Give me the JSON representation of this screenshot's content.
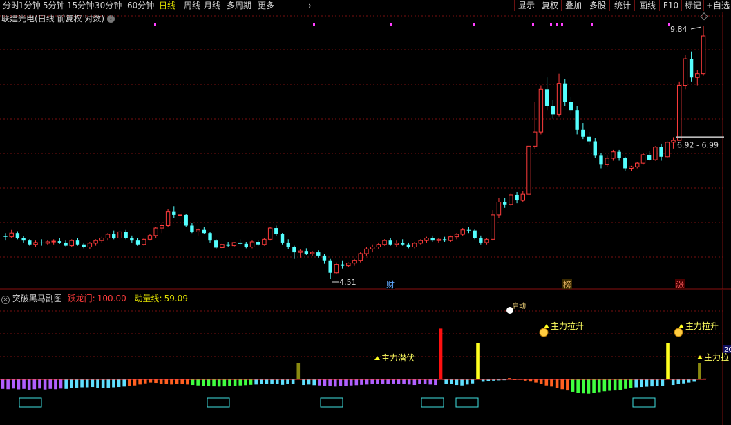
{
  "toolbar": {
    "periods": [
      "分时",
      "1分钟",
      "5分钟",
      "15分钟",
      "30分钟",
      "60分钟",
      "日线",
      "周线",
      "月线",
      "多周期",
      "更多"
    ],
    "active_period": "日线",
    "right_buttons": [
      "显示",
      "复权",
      "叠加",
      "多股",
      "统计",
      "画线",
      "F10",
      "标记",
      "+自选"
    ]
  },
  "stock": {
    "name": "联建光电",
    "mode": "(日线 前复权 对数)"
  },
  "indicator": {
    "name": "突破黑马副图",
    "yl_label": "跃龙门:",
    "yl_value": "100.00",
    "dl_label": "动量线:",
    "dl_value": "59.09",
    "side_value": "20"
  },
  "annotations": {
    "high_label": "9.84",
    "low_label": "4.51",
    "range_label": "6.92 - 6.99",
    "markers": [
      "财",
      "榜",
      "涨"
    ],
    "signals": [
      "启动",
      "主力潜伏",
      "主力拉升",
      "主力拉升",
      "主力拉"
    ]
  },
  "colors": {
    "up": "#ff3c3c",
    "down": "#54ffff",
    "grid": "#7a1010",
    "label": "#dcdc00"
  },
  "chart_data": {
    "type": "candlestick",
    "candles": [
      [
        5.15,
        5.2,
        5.08,
        5.14
      ],
      [
        5.14,
        5.25,
        5.12,
        5.2
      ],
      [
        5.2,
        5.23,
        5.1,
        5.12
      ],
      [
        5.12,
        5.15,
        5.05,
        5.08
      ],
      [
        5.08,
        5.1,
        5.0,
        5.02
      ],
      [
        5.02,
        5.08,
        4.98,
        5.05
      ],
      [
        5.05,
        5.1,
        5.0,
        5.04
      ],
      [
        5.04,
        5.09,
        5.01,
        5.06
      ],
      [
        5.06,
        5.1,
        5.02,
        5.07
      ],
      [
        5.07,
        5.12,
        5.03,
        5.05
      ],
      [
        5.05,
        5.08,
        4.99,
        5.0
      ],
      [
        5.0,
        5.1,
        4.98,
        5.08
      ],
      [
        5.08,
        5.12,
        5.0,
        5.02
      ],
      [
        5.02,
        5.05,
        4.96,
        4.98
      ],
      [
        4.98,
        5.06,
        4.95,
        5.04
      ],
      [
        5.04,
        5.1,
        5.0,
        5.08
      ],
      [
        5.08,
        5.14,
        5.05,
        5.12
      ],
      [
        5.12,
        5.2,
        5.08,
        5.18
      ],
      [
        5.18,
        5.24,
        5.1,
        5.12
      ],
      [
        5.12,
        5.24,
        5.1,
        5.22
      ],
      [
        5.22,
        5.25,
        5.1,
        5.12
      ],
      [
        5.12,
        5.16,
        5.05,
        5.08
      ],
      [
        5.08,
        5.12,
        5.0,
        5.02
      ],
      [
        5.02,
        5.12,
        5.0,
        5.1
      ],
      [
        5.1,
        5.18,
        5.08,
        5.16
      ],
      [
        5.16,
        5.3,
        5.12,
        5.28
      ],
      [
        5.28,
        5.36,
        5.2,
        5.32
      ],
      [
        5.32,
        5.6,
        5.3,
        5.55
      ],
      [
        5.55,
        5.65,
        5.45,
        5.5
      ],
      [
        5.5,
        5.55,
        5.46,
        5.5
      ],
      [
        5.5,
        5.52,
        5.3,
        5.32
      ],
      [
        5.32,
        5.36,
        5.2,
        5.22
      ],
      [
        5.22,
        5.28,
        5.16,
        5.25
      ],
      [
        5.25,
        5.3,
        5.18,
        5.2
      ],
      [
        5.2,
        5.22,
        5.05,
        5.08
      ],
      [
        5.08,
        5.1,
        4.95,
        4.97
      ],
      [
        4.97,
        5.04,
        4.95,
        5.02
      ],
      [
        5.02,
        5.06,
        4.98,
        5.0
      ],
      [
        5.0,
        5.06,
        4.98,
        5.05
      ],
      [
        5.05,
        5.1,
        5.0,
        5.03
      ],
      [
        5.03,
        5.06,
        4.96,
        4.98
      ],
      [
        4.98,
        5.08,
        4.96,
        5.06
      ],
      [
        5.06,
        5.08,
        5.0,
        5.02
      ],
      [
        5.02,
        5.12,
        5.0,
        5.1
      ],
      [
        5.1,
        5.3,
        5.08,
        5.28
      ],
      [
        5.28,
        5.32,
        5.15,
        5.18
      ],
      [
        5.18,
        5.2,
        5.02,
        5.05
      ],
      [
        5.05,
        5.1,
        4.95,
        4.98
      ],
      [
        4.98,
        5.0,
        4.8,
        4.9
      ],
      [
        4.9,
        4.95,
        4.82,
        4.92
      ],
      [
        4.92,
        4.96,
        4.86,
        4.88
      ],
      [
        4.88,
        4.92,
        4.84,
        4.9
      ],
      [
        4.9,
        4.93,
        4.82,
        4.85
      ],
      [
        4.85,
        4.87,
        4.73,
        4.78
      ],
      [
        4.78,
        4.8,
        4.51,
        4.6
      ],
      [
        4.6,
        4.75,
        4.58,
        4.72
      ],
      [
        4.72,
        4.78,
        4.66,
        4.7
      ],
      [
        4.7,
        4.75,
        4.68,
        4.74
      ],
      [
        4.74,
        4.8,
        4.7,
        4.78
      ],
      [
        4.78,
        4.9,
        4.75,
        4.88
      ],
      [
        4.88,
        4.98,
        4.85,
        4.95
      ],
      [
        4.95,
        5.02,
        4.9,
        4.98
      ],
      [
        4.98,
        5.05,
        4.95,
        5.02
      ],
      [
        5.02,
        5.1,
        5.0,
        5.08
      ],
      [
        5.08,
        5.12,
        5.0,
        5.02
      ],
      [
        5.02,
        5.08,
        4.98,
        5.04
      ],
      [
        5.04,
        5.1,
        5.0,
        5.02
      ],
      [
        5.02,
        5.05,
        4.96,
        4.98
      ],
      [
        4.98,
        5.06,
        4.96,
        5.04
      ],
      [
        5.04,
        5.1,
        5.02,
        5.08
      ],
      [
        5.08,
        5.14,
        5.05,
        5.12
      ],
      [
        5.12,
        5.16,
        5.06,
        5.08
      ],
      [
        5.08,
        5.12,
        5.05,
        5.1
      ],
      [
        5.1,
        5.14,
        5.06,
        5.08
      ],
      [
        5.08,
        5.16,
        5.06,
        5.14
      ],
      [
        5.14,
        5.2,
        5.1,
        5.18
      ],
      [
        5.18,
        5.28,
        5.15,
        5.25
      ],
      [
        5.25,
        5.3,
        5.2,
        5.24
      ],
      [
        5.24,
        5.26,
        5.1,
        5.12
      ],
      [
        5.12,
        5.16,
        5.02,
        5.05
      ],
      [
        5.05,
        5.12,
        5.02,
        5.1
      ],
      [
        5.1,
        5.58,
        5.08,
        5.5
      ],
      [
        5.5,
        5.8,
        5.45,
        5.72
      ],
      [
        5.72,
        5.8,
        5.62,
        5.68
      ],
      [
        5.68,
        5.88,
        5.65,
        5.85
      ],
      [
        5.85,
        5.9,
        5.7,
        5.75
      ],
      [
        5.75,
        5.92,
        5.72,
        5.86
      ],
      [
        5.86,
        6.9,
        5.82,
        6.8
      ],
      [
        6.8,
        7.8,
        6.75,
        7.1
      ],
      [
        7.1,
        8.2,
        7.05,
        8.1
      ],
      [
        8.1,
        8.4,
        7.6,
        7.7
      ],
      [
        7.7,
        7.85,
        7.4,
        7.5
      ],
      [
        7.5,
        8.5,
        7.45,
        8.25
      ],
      [
        8.25,
        8.35,
        7.7,
        7.8
      ],
      [
        7.8,
        7.9,
        7.5,
        7.6
      ],
      [
        7.6,
        7.7,
        7.05,
        7.15
      ],
      [
        7.15,
        7.3,
        6.95,
        7.0
      ],
      [
        7.0,
        7.1,
        6.82,
        6.9
      ],
      [
        6.9,
        6.98,
        6.55,
        6.6
      ],
      [
        6.6,
        6.65,
        6.35,
        6.42
      ],
      [
        6.42,
        6.6,
        6.38,
        6.55
      ],
      [
        6.55,
        6.72,
        6.5,
        6.68
      ],
      [
        6.68,
        6.72,
        6.5,
        6.55
      ],
      [
        6.55,
        6.58,
        6.3,
        6.35
      ],
      [
        6.35,
        6.4,
        6.3,
        6.38
      ],
      [
        6.38,
        6.48,
        6.35,
        6.45
      ],
      [
        6.45,
        6.65,
        6.42,
        6.62
      ],
      [
        6.62,
        6.7,
        6.5,
        6.52
      ],
      [
        6.52,
        6.8,
        6.5,
        6.78
      ],
      [
        6.78,
        6.85,
        6.5,
        6.58
      ],
      [
        6.58,
        6.9,
        6.55,
        6.88
      ],
      [
        6.88,
        6.99,
        6.75,
        6.92
      ],
      [
        6.92,
        8.3,
        6.92,
        8.2
      ],
      [
        8.2,
        9.0,
        8.1,
        8.9
      ],
      [
        8.9,
        9.1,
        8.3,
        8.4
      ],
      [
        8.4,
        8.6,
        8.2,
        8.5
      ],
      [
        8.5,
        9.84,
        8.45,
        9.55
      ]
    ],
    "high": 9.84,
    "low": 4.51,
    "indicator_bars": [
      -60,
      -62,
      -58,
      -63,
      -60,
      -65,
      -62,
      -58,
      -64,
      -60,
      -62,
      -58,
      -60,
      -55,
      -52,
      -50,
      -50,
      -48,
      -52,
      -55,
      -52,
      -50,
      -48,
      -45,
      -40,
      -38,
      -32,
      -25,
      -20,
      -22,
      -28,
      -30,
      -32,
      -30,
      -28,
      -32,
      -35,
      -38,
      -40,
      -42,
      -44,
      -45,
      -44,
      -42,
      -40,
      -38,
      -36,
      -34,
      -32,
      -30,
      -28,
      -26,
      -30,
      -34,
      -28,
      -30,
      100,
      -35,
      -32,
      -36,
      -38,
      -40,
      -42,
      -45,
      -42,
      -40,
      -38,
      -36,
      -34,
      -32,
      -30,
      -28,
      -30,
      -28,
      -26,
      -28,
      -30,
      -32,
      -35,
      -30,
      -28,
      -32,
      -35,
      320,
      -28,
      -30,
      -35,
      -38,
      -32,
      -25,
      230,
      -15,
      -10,
      -8,
      -6,
      -5,
      8,
      -4,
      -3,
      -8,
      -14,
      -20,
      -28,
      -38,
      -45,
      -55,
      -62,
      -70,
      -78,
      -85,
      -88,
      -90,
      -86,
      -80,
      -75,
      -72,
      -70,
      -66,
      -60,
      -55,
      -50,
      -48,
      -46,
      -44,
      -42,
      -40,
      230,
      -35,
      -30,
      -25,
      -20,
      -15,
      100,
      5
    ]
  }
}
